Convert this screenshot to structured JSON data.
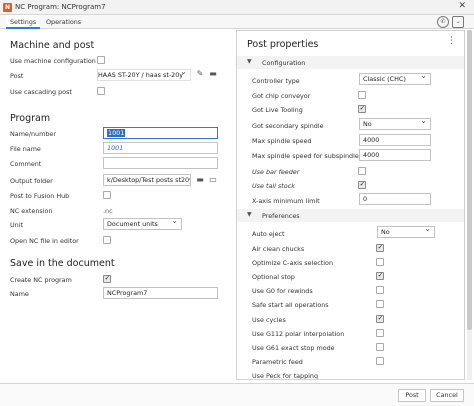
{
  "window": {
    "title": "NC Program: NCProgram7",
    "app_icon_glyph": "N"
  },
  "tabs": [
    {
      "label": "Settings",
      "active": true
    },
    {
      "label": "Operations",
      "active": false
    }
  ],
  "header_icons": [
    "help-phone-icon",
    "expand-icon"
  ],
  "left": {
    "machine_and_post": {
      "heading": "Machine and post",
      "use_machine_configuration": {
        "label": "Use machine configuration",
        "checked": false
      },
      "post": {
        "label": "Post",
        "value": "HAAS ST-20Y / haas st-20y"
      },
      "use_cascading_post": {
        "label": "Use cascading post",
        "checked": false
      }
    },
    "program": {
      "heading": "Program",
      "name_number": {
        "label": "Name/number",
        "value": "1001"
      },
      "file_name": {
        "label": "File name",
        "value": "1001"
      },
      "comment": {
        "label": "Comment",
        "value": ""
      },
      "output_folder": {
        "label": "Output folder",
        "value": "k/Desktop/Test posts st20y"
      },
      "post_to_fusion_hub": {
        "label": "Post to Fusion Hub",
        "checked": false
      },
      "nc_extension": {
        "label": "NC extension",
        "value": ".nc"
      },
      "unit": {
        "label": "Unit",
        "value": "Document units"
      },
      "open_nc_file": {
        "label": "Open NC file in editor",
        "checked": false
      }
    },
    "save_in_document": {
      "heading": "Save in the document",
      "create_nc_program": {
        "label": "Create NC program",
        "checked": true
      },
      "name": {
        "label": "Name",
        "value": "NCProgram7"
      }
    }
  },
  "post_properties": {
    "title": "Post properties",
    "configuration": {
      "label": "Configuration",
      "rows": {
        "controller_type": {
          "label": "Controller type",
          "value": "Classic (CHC)"
        },
        "chip_conveyor": {
          "label": "Got chip conveyor",
          "checked": false
        },
        "live_tooling": {
          "label": "Got Live Tooling",
          "checked": true
        },
        "secondary_spindle": {
          "label": "Got secondary spindle",
          "value": "No"
        },
        "max_spindle_speed": {
          "label": "Max spindle speed",
          "value": "4000"
        },
        "max_spindle_speed_sub": {
          "label": "Max spindle speed for subspindle",
          "value": "4000"
        },
        "use_bar_feeder": {
          "label": "Use bar feeder",
          "checked": false
        },
        "use_tail_stock": {
          "label": "Use tail stock",
          "checked": true
        },
        "x_axis_min_limit": {
          "label": "X-axis minimum limit",
          "value": "0"
        }
      }
    },
    "preferences": {
      "label": "Preferences",
      "rows": {
        "auto_eject": {
          "label": "Auto eject",
          "value": "No"
        },
        "air_clean_chucks": {
          "label": "Air clean chucks",
          "checked": true
        },
        "optimize_c_axis": {
          "label": "Optimize C-axis selection",
          "checked": false
        },
        "optional_stop": {
          "label": "Optional stop",
          "checked": true
        },
        "use_g0_rewinds": {
          "label": "Use G0 for rewinds",
          "checked": false
        },
        "safe_start_all": {
          "label": "Safe start all operations",
          "checked": false
        },
        "use_cycles": {
          "label": "Use cycles",
          "checked": true
        },
        "use_g112": {
          "label": "Use G112 polar interpolation",
          "checked": false
        },
        "use_g61": {
          "label": "Use G61 exact stop mode",
          "checked": false
        },
        "parametric_feed": {
          "label": "Parametric feed",
          "checked": false
        },
        "use_peck_tapping": {
          "label": "Use Peck for tapping"
        }
      }
    }
  },
  "footer": {
    "post_label": "Post",
    "cancel_label": "Cancel"
  }
}
